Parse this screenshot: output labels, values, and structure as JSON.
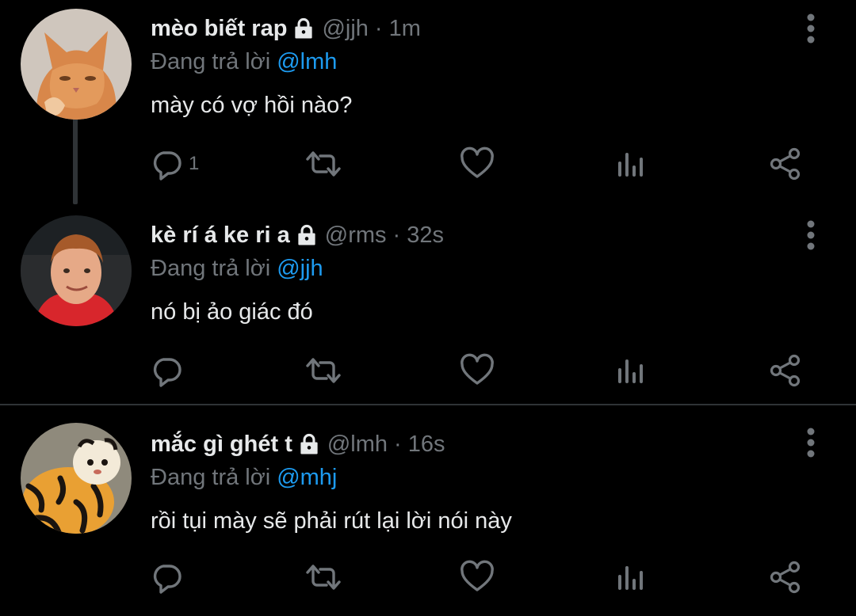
{
  "reply_prefix": "Đang trả lời",
  "tweets": [
    {
      "name": "mèo biết rap",
      "handle": "@jjh",
      "separator": "·",
      "time": "1m",
      "reply_to": "@lmh",
      "text": "mày có vợ hồi nào?",
      "reply_count": "1",
      "avatar_icon": "orange-cat-avatar"
    },
    {
      "name": "kè rí á ke ri a",
      "handle": "@rms",
      "separator": "·",
      "time": "32s",
      "reply_to": "@jjh",
      "text": "nó bị ảo giác đó",
      "reply_count": "",
      "avatar_icon": "child-avatar"
    },
    {
      "name": "mắc gì ghét t",
      "handle": "@lmh",
      "separator": "·",
      "time": "16s",
      "reply_to": "@mhj",
      "text": "rồi tụi mày sẽ phải rút lại lời nói này",
      "reply_count": "",
      "avatar_icon": "tiger-toy-avatar"
    }
  ],
  "icons": {
    "reply": "reply-icon",
    "retweet": "retweet-icon",
    "like": "heart-icon",
    "views": "analytics-icon",
    "share": "share-icon",
    "more": "more-options-icon",
    "lock": "lock-icon"
  },
  "colors": {
    "background": "#000000",
    "text": "#e7e9ea",
    "secondary": "#71767b",
    "link": "#1d9bf0",
    "divider": "#2f3336"
  }
}
